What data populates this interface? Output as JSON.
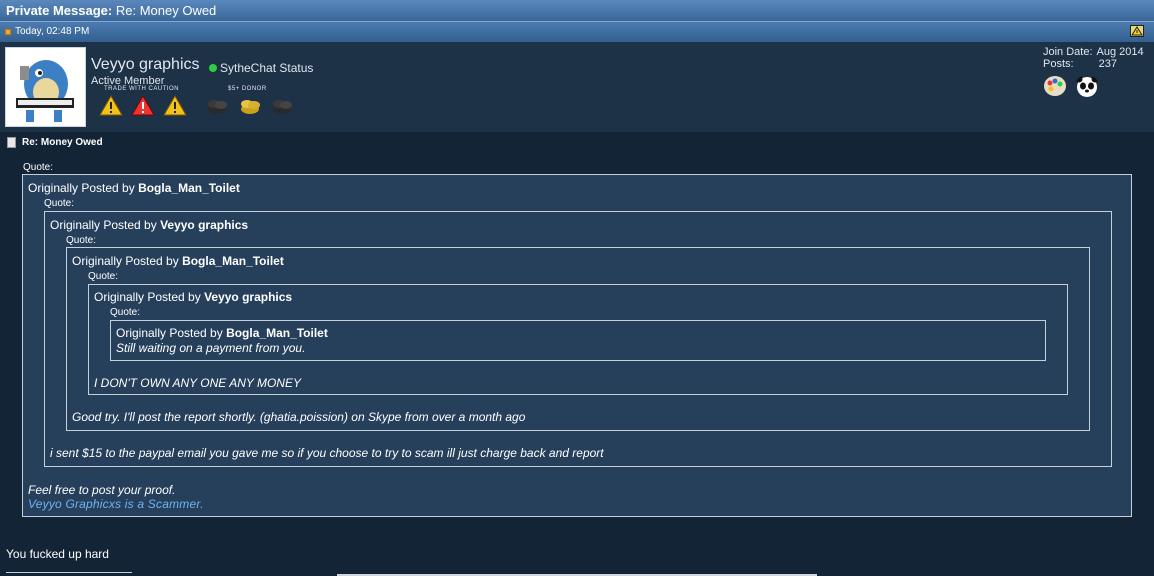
{
  "window": {
    "title_prefix": "Private Message:",
    "title": "Re: Money Owed",
    "timestamp": "Today, 02:48 PM"
  },
  "user": {
    "name": "Veyyo graphics",
    "chat_status": "SytheChat Status",
    "rank": "Active Member",
    "badge1_label": "TRADE WITH CAUTION",
    "badge2_label": "$5+ DONOR",
    "join_date_label": "Join Date:",
    "join_date": "Aug 2014",
    "posts_label": "Posts:",
    "posts": "237"
  },
  "post": {
    "title": "Re: Money Owed",
    "quote_label": "Quote:",
    "posted_by": "Originally Posted by",
    "posted_by_cap": "Originally Posted by",
    "q1": {
      "posted_by": "Originally Posted by",
      "author": "Bogla_Man_Toilet",
      "line1": "Feel free to post your proof.",
      "link": "Veyyo Graphicxs is a Scammer."
    },
    "q2": {
      "posted_by": "Originally Posted by",
      "author": "Veyyo graphics",
      "text": "i sent $15 to the paypal email you gave me so if you choose to try to scam ill just charge back and report"
    },
    "q3": {
      "posted_by": "Originally Posted by",
      "author": "Bogla_Man_Toilet",
      "text": "Good try. I'll post the report shortly. (ghatia.poission) on Skype from over a month ago"
    },
    "q4": {
      "posted_by": "Originally Posted by",
      "author": "Veyyo graphics",
      "text": "I DON'T OWN ANY ONE ANY MONEY"
    },
    "q5": {
      "posted_by": "Originally Posted by",
      "author": "Bogla_Man_Toilet",
      "text": "Still waiting on a payment from you."
    },
    "body": "You fucked up hard"
  },
  "colors": {
    "background": "#0f1d2c",
    "quote_box": "#26405c",
    "link": "#6fb3f2",
    "online": "#2ecc40"
  },
  "icons": {
    "warning": "warning-icon",
    "paint": "palette-icon",
    "panda": "panda-icon",
    "document": "document-icon"
  }
}
